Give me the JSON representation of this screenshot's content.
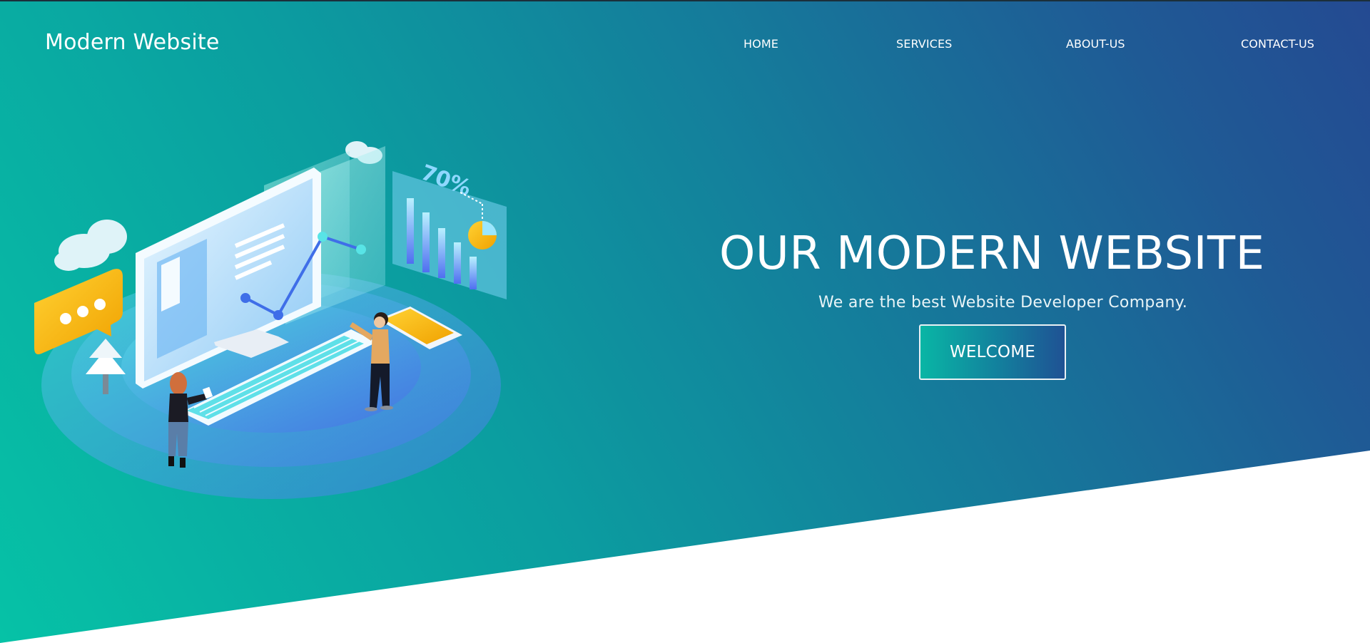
{
  "site": {
    "logo": "Modern Website"
  },
  "nav": {
    "items": [
      {
        "label": "HOME"
      },
      {
        "label": "SERVICES"
      },
      {
        "label": "ABOUT-US"
      },
      {
        "label": "CONTACT-US"
      }
    ]
  },
  "hero": {
    "headline": "OUR MODERN WEBSITE",
    "subheadline": "We are the best Website Developer Company.",
    "button_label": "WELCOME",
    "illustration_badge": "70%"
  },
  "colors": {
    "gradient_start": "#06c2a6",
    "gradient_end": "#244a92",
    "text": "#ffffff",
    "accent_yellow": "#f5b400"
  }
}
